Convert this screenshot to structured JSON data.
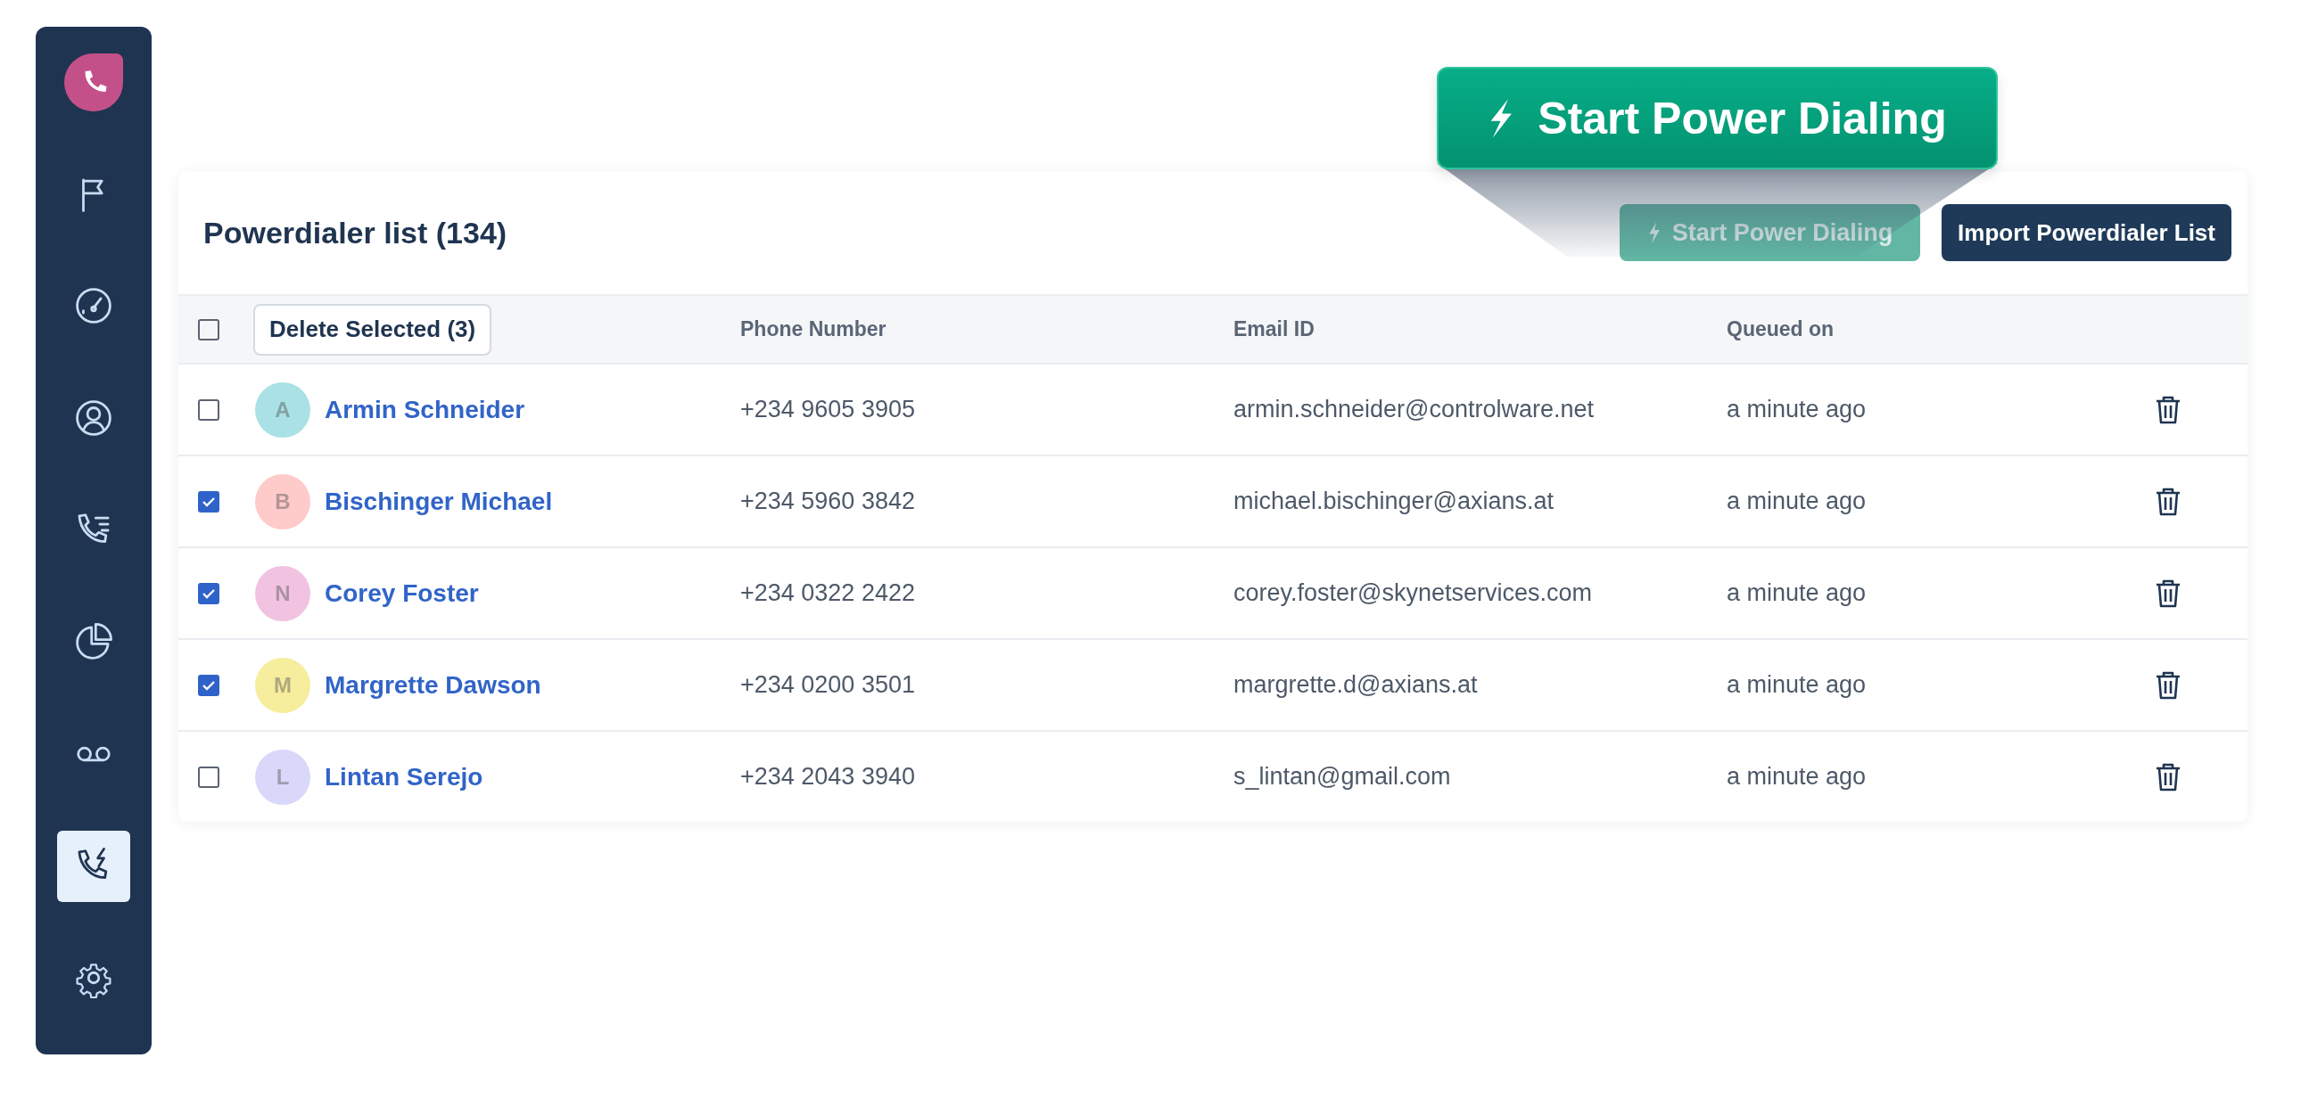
{
  "sidebar": {
    "items": [
      {
        "selected": false
      },
      {
        "selected": false
      },
      {
        "selected": false
      },
      {
        "selected": false
      },
      {
        "selected": false
      },
      {
        "selected": false
      },
      {
        "selected": true
      },
      {
        "selected": false
      }
    ]
  },
  "callout": {
    "label": "Start Power Dialing"
  },
  "card": {
    "title": "Powerdialer list (134)",
    "buttons": [
      {
        "kind": "start",
        "label": "Start Power Dialing"
      },
      {
        "kind": "import",
        "label": "Import Powerdialer List"
      }
    ],
    "table": {
      "select_all": {
        "checked": false
      },
      "delete_button": "Delete Selected (3)",
      "columns": [
        "Phone Number",
        "Email ID",
        "Queued on"
      ],
      "rows": [
        {
          "checked": false,
          "initial": "A",
          "color": "#a9e1e6",
          "name": "Armin Schneider",
          "phone": "+234 9605 3905",
          "email": "armin.schneider@controlware.net",
          "queued": "a minute ago"
        },
        {
          "checked": true,
          "initial": "B",
          "color": "#ffcaca",
          "name": "Bischinger Michael",
          "phone": "+234 5960 3842",
          "email": "michael.bischinger@axians.at",
          "queued": "a minute ago"
        },
        {
          "checked": true,
          "initial": "N",
          "color": "#f1c3e1",
          "name": "Corey Foster",
          "phone": "+234 0322 2422",
          "email": "corey.foster@skynetservices.com",
          "queued": "a minute ago"
        },
        {
          "checked": true,
          "initial": "M",
          "color": "#f6ed9d",
          "name": "Margrette Dawson",
          "phone": "+234 0200 3501",
          "email": "margrette.d@axians.at",
          "queued": "a minute ago"
        },
        {
          "checked": false,
          "initial": "L",
          "color": "#d9d7fa",
          "name": "Lintan Serejo",
          "phone": "+234 2043 3940",
          "email": "s_lintan@gmail.com",
          "queued": "a minute ago"
        }
      ]
    }
  }
}
